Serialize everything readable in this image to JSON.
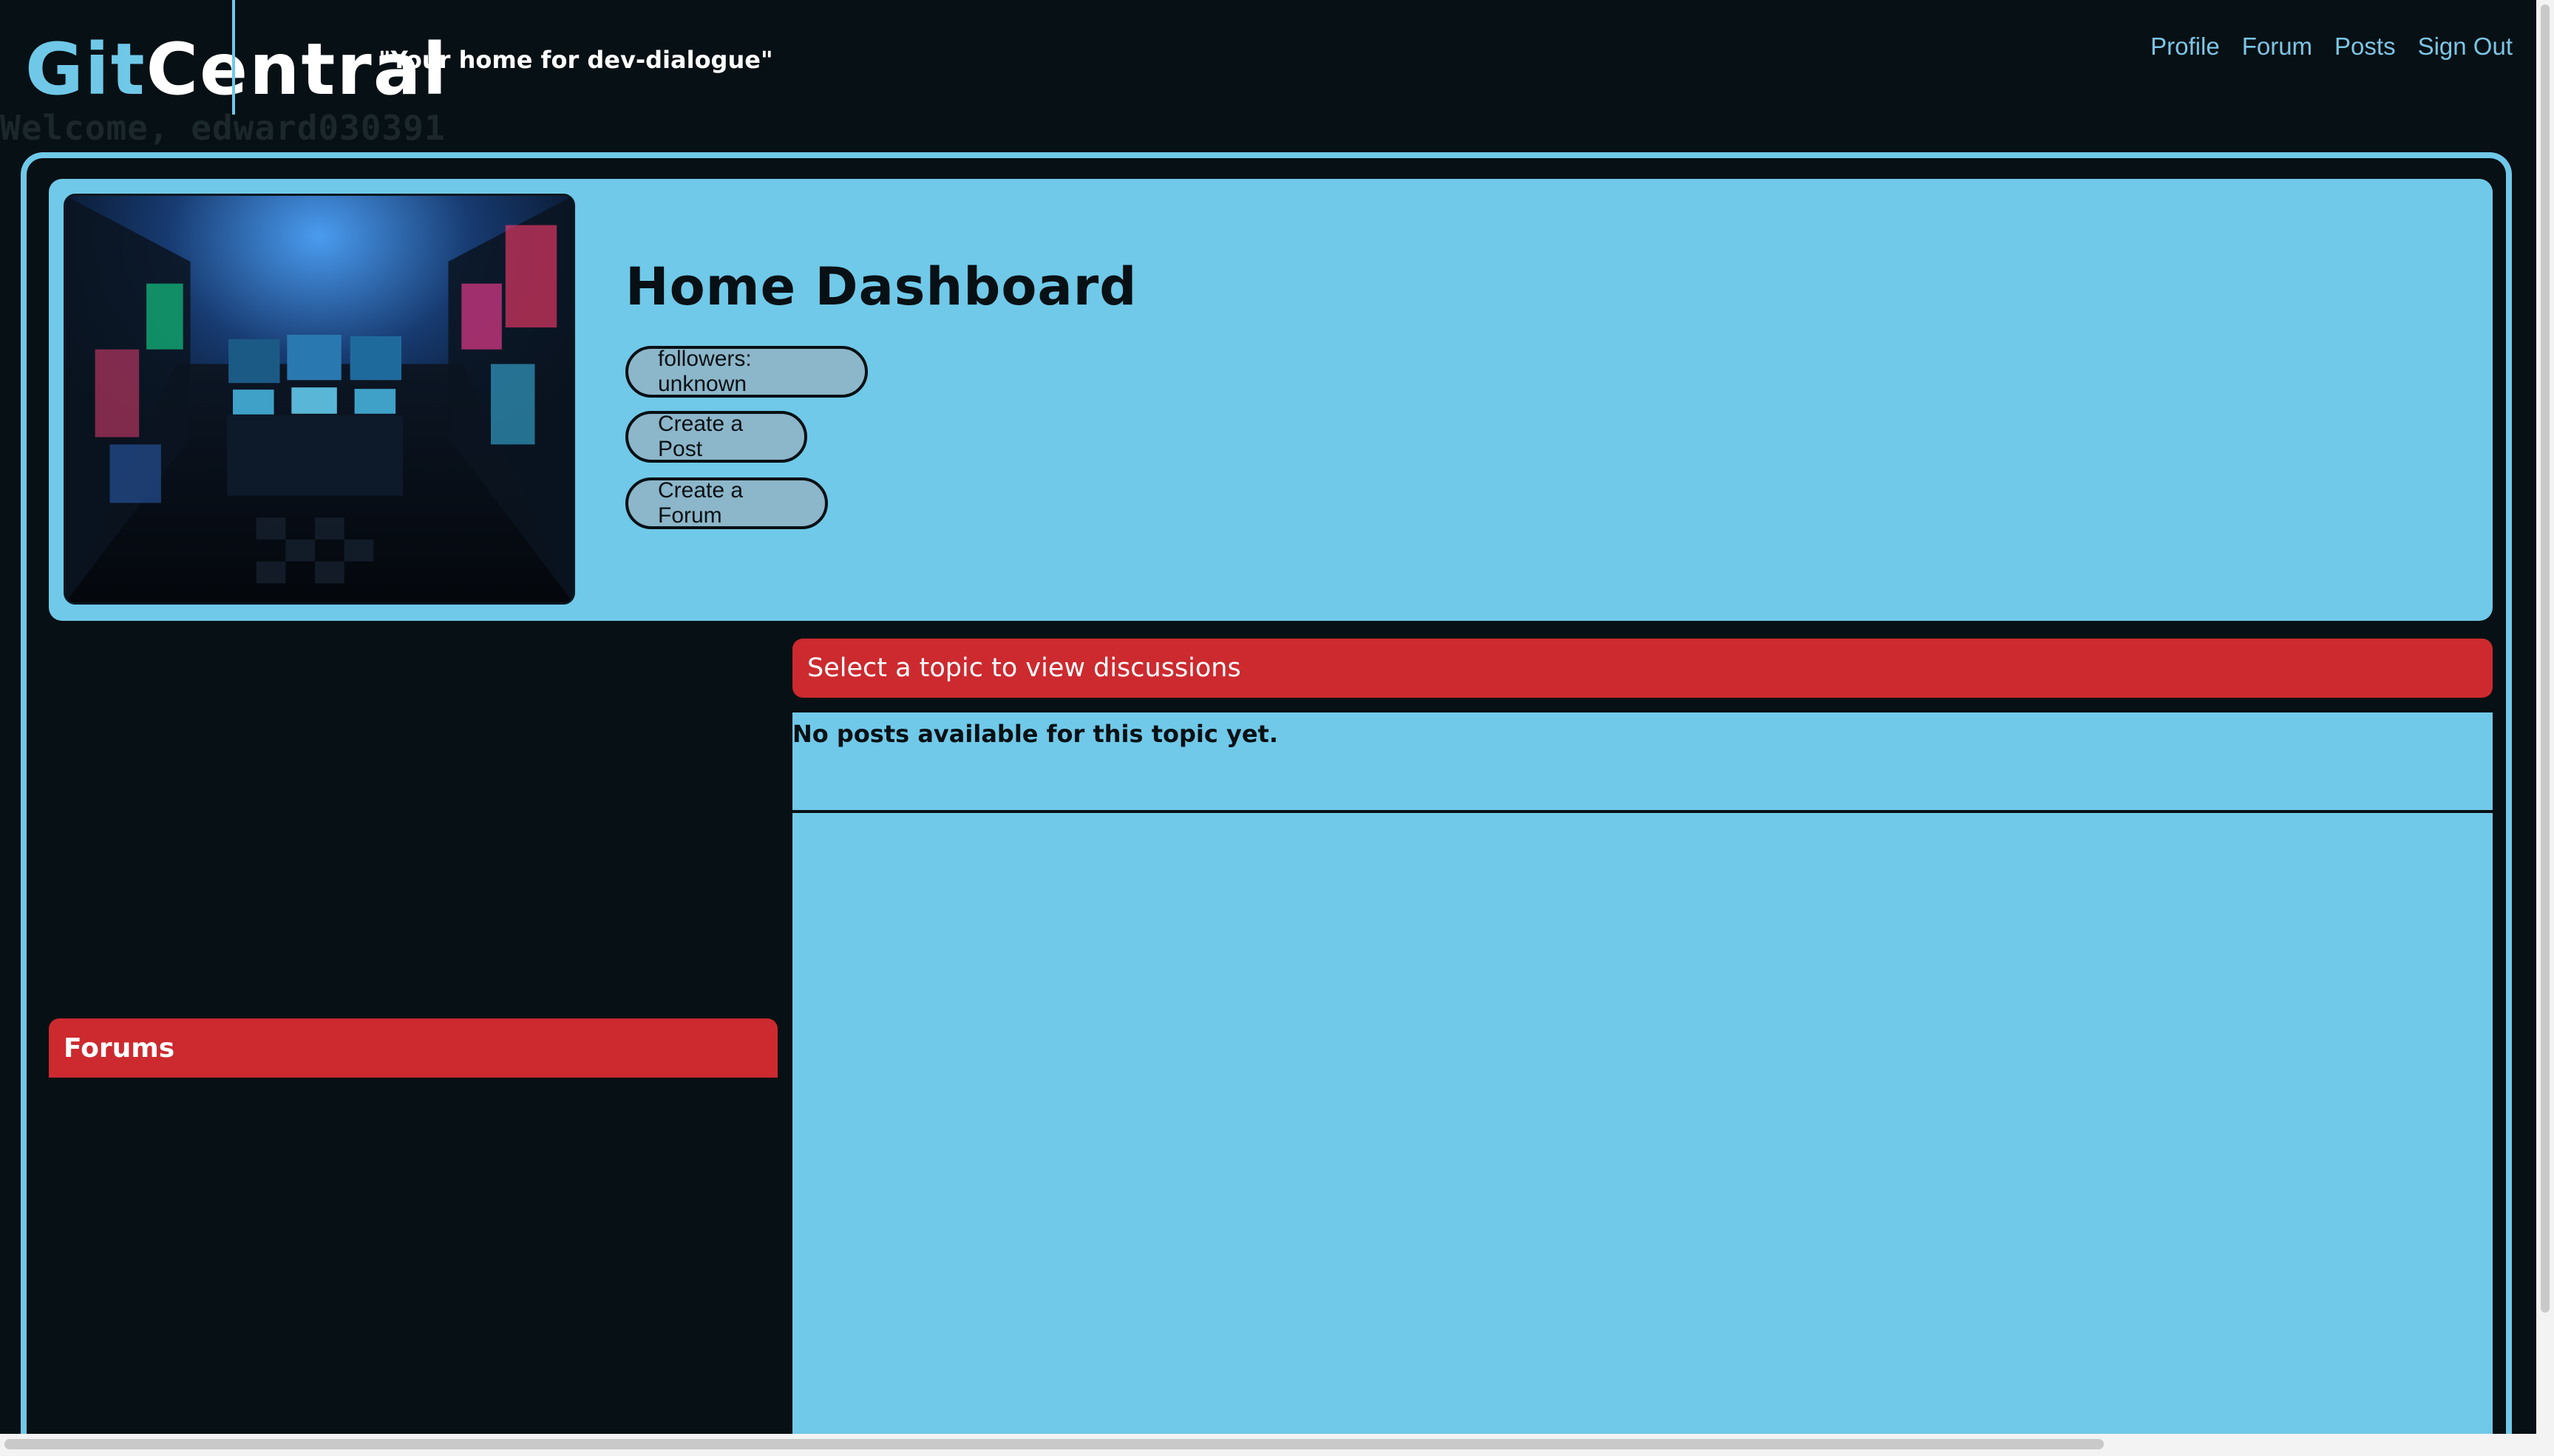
{
  "brand": {
    "logo_part1": "Git",
    "logo_part2": "Central",
    "tagline": "\"Your home for dev-dialogue\""
  },
  "nav": {
    "items": [
      {
        "label": "Profile"
      },
      {
        "label": "Forum"
      },
      {
        "label": "Posts"
      },
      {
        "label": "Sign Out"
      }
    ]
  },
  "welcome": "Welcome, edward030391",
  "hero": {
    "title": "Home Dashboard",
    "followers_label": "followers: unknown",
    "create_post_label": "Create a Post",
    "create_forum_label": "Create a Forum",
    "image_alt": "arcade-room-photo"
  },
  "forums": {
    "header": "Forums"
  },
  "discussions": {
    "header": "Select a topic to view discussions",
    "empty_message": "No posts available for this topic yet."
  },
  "colors": {
    "background": "#071014",
    "accent_blue": "#70c9e8",
    "accent_red": "#cc2a2f",
    "pill_fill": "#8cb6c9"
  }
}
